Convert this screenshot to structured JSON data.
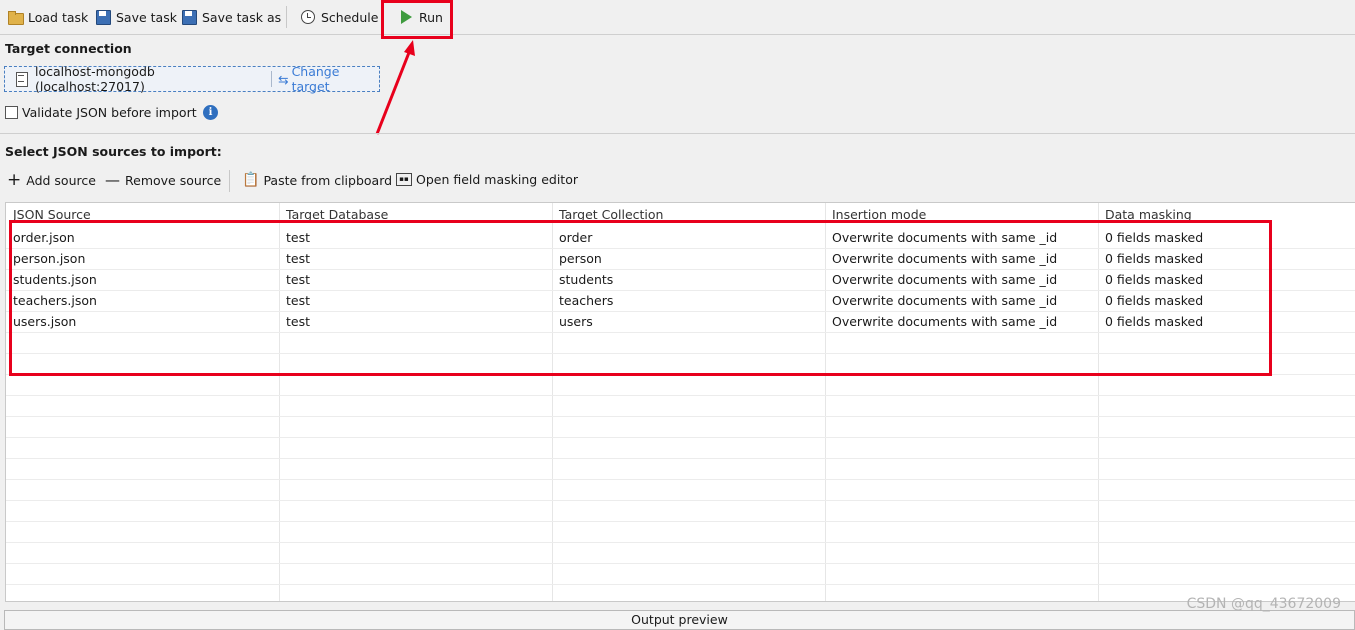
{
  "toolbar": {
    "load_task": "Load task",
    "save_task": "Save task",
    "save_task_as": "Save task as",
    "schedule": "Schedule",
    "run": "Run"
  },
  "target_connection": {
    "title": "Target connection",
    "connection_name": "localhost-mongodb (localhost:27017)",
    "change_target": "Change target",
    "validate_label": "Validate JSON before import",
    "validate_checked": false
  },
  "sources": {
    "title": "Select JSON sources to import:",
    "add_source": "Add source",
    "remove_source": "Remove source",
    "paste_clipboard": "Paste from clipboard",
    "masking_editor": "Open field masking editor"
  },
  "table": {
    "headers": [
      "JSON Source",
      "Target Database",
      "Target Collection",
      "Insertion mode",
      "Data masking"
    ],
    "rows": [
      [
        "order.json",
        "test",
        "order",
        "Overwrite documents with same _id",
        "0 fields masked"
      ],
      [
        "person.json",
        "test",
        "person",
        "Overwrite documents with same _id",
        "0 fields masked"
      ],
      [
        "students.json",
        "test",
        "students",
        "Overwrite documents with same _id",
        "0 fields masked"
      ],
      [
        "teachers.json",
        "test",
        "teachers",
        "Overwrite documents with same _id",
        "0 fields masked"
      ],
      [
        "users.json",
        "test",
        "users",
        "Overwrite documents with same _id",
        "0 fields masked"
      ]
    ]
  },
  "output_preview": "Output preview",
  "watermark": "CSDN @qq_43672009",
  "colors": {
    "highlight": "#e8001c",
    "link": "#3a7bd5",
    "run_icon": "#3f9b3f"
  }
}
